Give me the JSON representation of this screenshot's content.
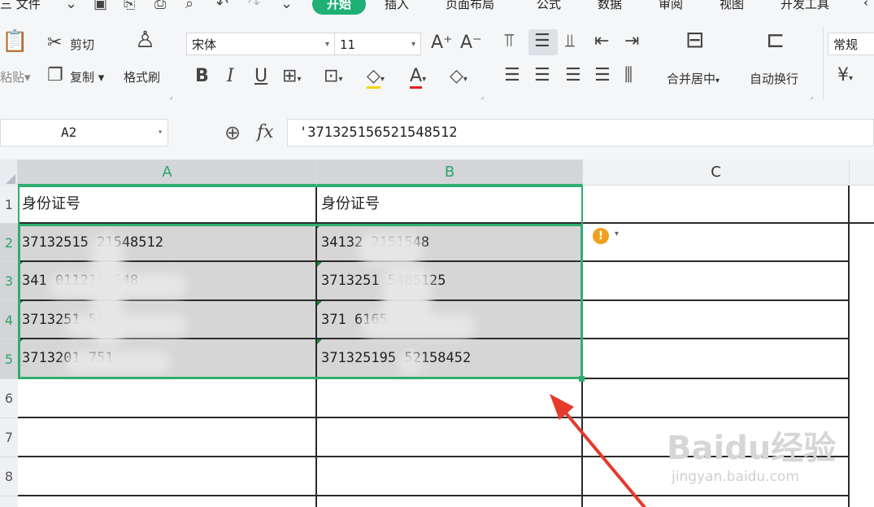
{
  "menubar": {
    "file": "三 文件",
    "items": [
      "开始",
      "插入",
      "页面布局",
      "公式",
      "数据",
      "审阅",
      "视图",
      "开发工具"
    ],
    "active": "开始"
  },
  "ribbon": {
    "paste": "粘贴",
    "cut": "剪切",
    "copy": "复制",
    "format_painter": "格式刷",
    "font_name": "宋体",
    "font_size": "11",
    "bold": "B",
    "italic": "I",
    "underline": "U",
    "merge_center": "合并居中",
    "wrap_text": "自动换行",
    "number_format": "常规",
    "currency": "¥"
  },
  "formula_bar": {
    "name_box": "A2",
    "fx": "fx",
    "content": "'371325156521548512"
  },
  "sheet": {
    "columns": [
      "A",
      "B",
      "C"
    ],
    "row_numbers": [
      "1",
      "2",
      "3",
      "4",
      "5",
      "6",
      "7",
      "8"
    ],
    "header_row": [
      "身份证号",
      "身份证号"
    ],
    "rows": [
      [
        "37132515    21548512",
        "34132      2151548"
      ],
      [
        "341        0112151548",
        "3713251      5485125"
      ],
      [
        "3713251            55",
        "371          6165"
      ],
      [
        "3713201        751",
        "371325195  52158452"
      ]
    ]
  },
  "colors": {
    "accent": "#1fb076",
    "selection_border": "#2fae6f",
    "arrow": "#e53a2c",
    "warning": "#f0a020"
  },
  "icons": {
    "warning": "warning-icon",
    "dropdown": "chevron-down-icon",
    "zoom": "zoom-icon"
  },
  "watermark": {
    "main": "Baidu经验",
    "sub": "jingyan.baidu.com"
  }
}
